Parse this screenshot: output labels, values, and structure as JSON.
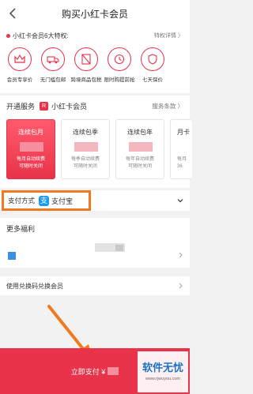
{
  "header": {
    "title": "购买小红卡会员"
  },
  "privileges": {
    "heading": "小红卡会员6大特权:",
    "detail_link": "特权详情 〉",
    "items": [
      {
        "label": "会员专享价",
        "icon": "crown-icon"
      },
      {
        "label": "无门槛包邮",
        "icon": "delivery-truck-icon"
      },
      {
        "label": "跨境商品包税",
        "icon": "no-tax-icon"
      },
      {
        "label": "限时购提前抢",
        "icon": "clock-icon"
      },
      {
        "label": "七天保价",
        "icon": "price-protect-icon"
      }
    ]
  },
  "service": {
    "heading": "开通服务",
    "card_name": "小红卡会员",
    "badge": "R",
    "terms_link": "服务条款 〉",
    "plans": [
      {
        "name": "连续包月",
        "desc_line1": "每月自动续费",
        "desc_line2": "可随时关闭",
        "selected": true
      },
      {
        "name": "连续包季",
        "desc_line1": "每季自动续费",
        "desc_line2": "可随时关闭",
        "selected": false
      },
      {
        "name": "连续包年",
        "desc_line1": "每年自动续费",
        "desc_line2": "可随时关闭",
        "selected": false
      },
      {
        "name": "月卡",
        "desc_line1": "每月",
        "desc_line2": "36",
        "selected": false
      }
    ]
  },
  "payment": {
    "label": "支付方式",
    "method": "支付宝",
    "method_icon": "alipay-icon"
  },
  "more": {
    "title": "更多福利"
  },
  "code": {
    "label": "使用兑换码兑换会员"
  },
  "checkout": {
    "label": "立即支付 ¥",
    "amount": ""
  },
  "watermark": {
    "title": "软件无忧",
    "url": "www.rjwuyou.com"
  },
  "colors": {
    "accent": "#e8334a",
    "highlight": "#f07a22",
    "alipay": "#1a9bf0"
  }
}
